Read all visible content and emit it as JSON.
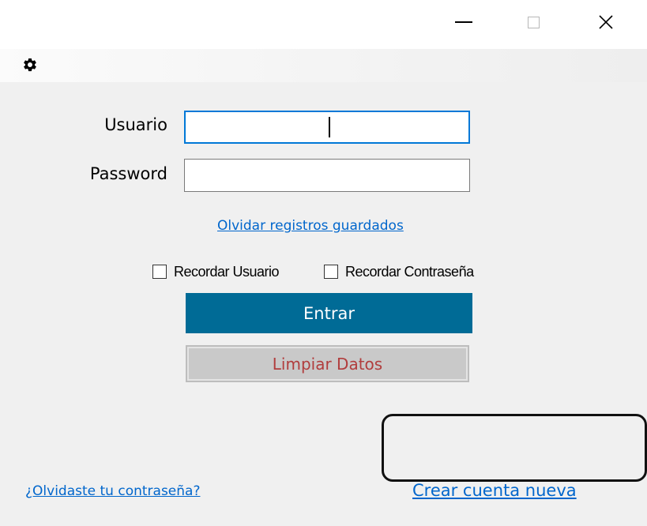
{
  "window": {
    "minimize_icon": "minimize-icon",
    "maximize_icon": "maximize-icon",
    "close_icon": "close-icon",
    "close_glyph": "✕"
  },
  "toolbar": {
    "settings_icon": "gear-icon"
  },
  "form": {
    "username_label": "Usuario",
    "username_value": "",
    "password_label": "Password",
    "password_value": "",
    "forget_saved_link": "Olvidar registros guardados",
    "remember_user_label": "Recordar Usuario",
    "remember_user_checked": false,
    "remember_password_label": "Recordar Contraseña",
    "remember_password_checked": false,
    "login_button": "Entrar",
    "clear_button": "Limpiar Datos"
  },
  "footer": {
    "forgot_password_link": "¿Olvidaste tu contraseña?",
    "create_account_link": "Crear cuenta nueva"
  },
  "colors": {
    "accent": "#006b96",
    "link": "#0066cc",
    "clear_text": "#b13d3d",
    "focus_border": "#0078d7"
  }
}
